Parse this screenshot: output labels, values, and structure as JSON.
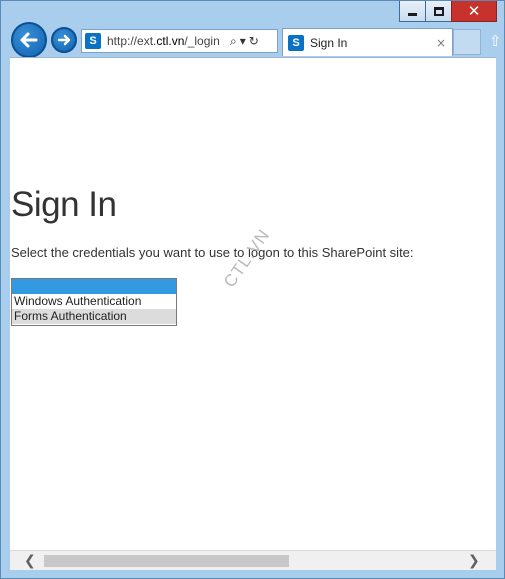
{
  "window": {
    "minimize_icon": "minimize-icon",
    "maximize_icon": "maximize-icon",
    "close_glyph": "✕"
  },
  "nav": {
    "back_icon": "arrow-left-icon",
    "forward_icon": "arrow-right-icon",
    "url_prefix": "http://ext.",
    "url_domain": "ctl.vn",
    "url_suffix": "/_login",
    "search_glyph": "⌕",
    "dropdown_glyph": "▾",
    "refresh_glyph": "↻"
  },
  "tab": {
    "site_icon_letter": "S",
    "title": "Sign In",
    "close_glyph": "×"
  },
  "page": {
    "title": "Sign In",
    "instruction": "Select the credentials you want to use to logon to this SharePoint site:",
    "options": [
      "",
      "Windows Authentication",
      "Forms Authentication"
    ],
    "watermark": "CTL.VN"
  },
  "scrollbar": {
    "left_glyph": "❮",
    "right_glyph": "❯",
    "thumb_fraction": 0.5
  },
  "colors": {
    "chrome": "#a9cdec",
    "close_button": "#c7322d",
    "selected_option": "#3399e1",
    "hover_option": "#dcdcdc"
  }
}
